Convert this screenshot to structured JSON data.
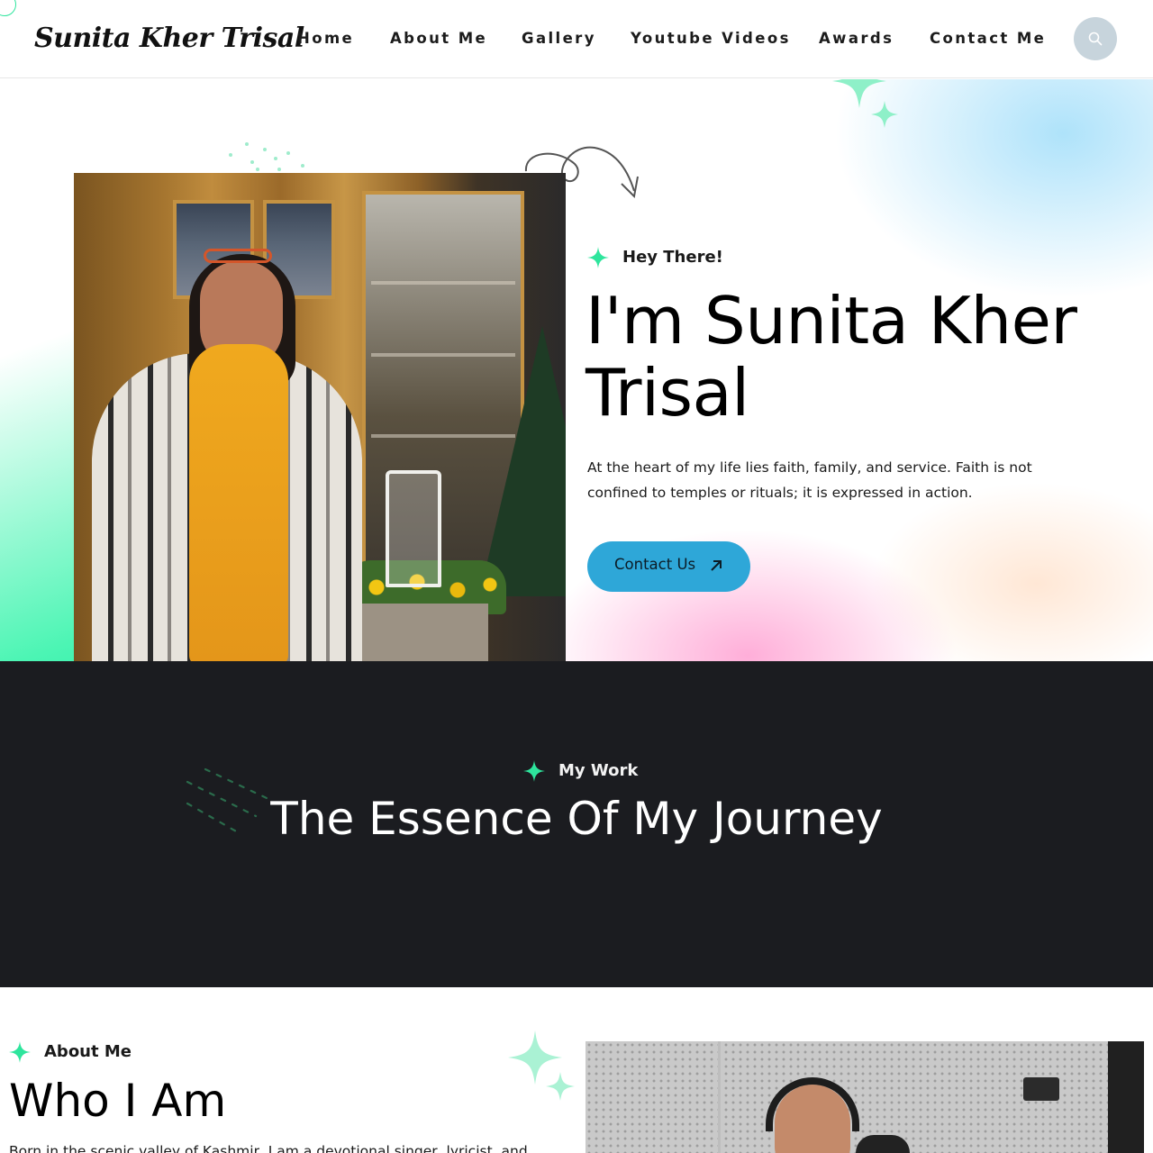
{
  "header": {
    "logo_text": "Sunita Kher Trisal",
    "nav": [
      "Home",
      "About Me",
      "Gallery",
      "Youtube Videos",
      "Awards",
      "Contact Me"
    ],
    "search_icon": "search-icon"
  },
  "hero": {
    "eyebrow": "Hey There!",
    "title": "I'm Sunita Kher Trisal",
    "description": "At the heart of my life lies faith, family, and service. Faith is not confined to temples or rituals; it is expressed in action.",
    "cta_label": "Contact Us",
    "cta_icon": "arrow-up-right-icon",
    "photo": "portrait-photo"
  },
  "work": {
    "eyebrow": "My Work",
    "title": "The Essence Of My Journey"
  },
  "about": {
    "eyebrow": "About Me",
    "title": "Who I Am",
    "text": "Born in the scenic valley of Kashmir, I am a devotional singer, lyricist, and",
    "photo": "studio-recording-photo"
  },
  "colors": {
    "accent_green": "#2ee59d",
    "button_blue": "#2ea7d8",
    "dark_section": "#1b1c20"
  }
}
